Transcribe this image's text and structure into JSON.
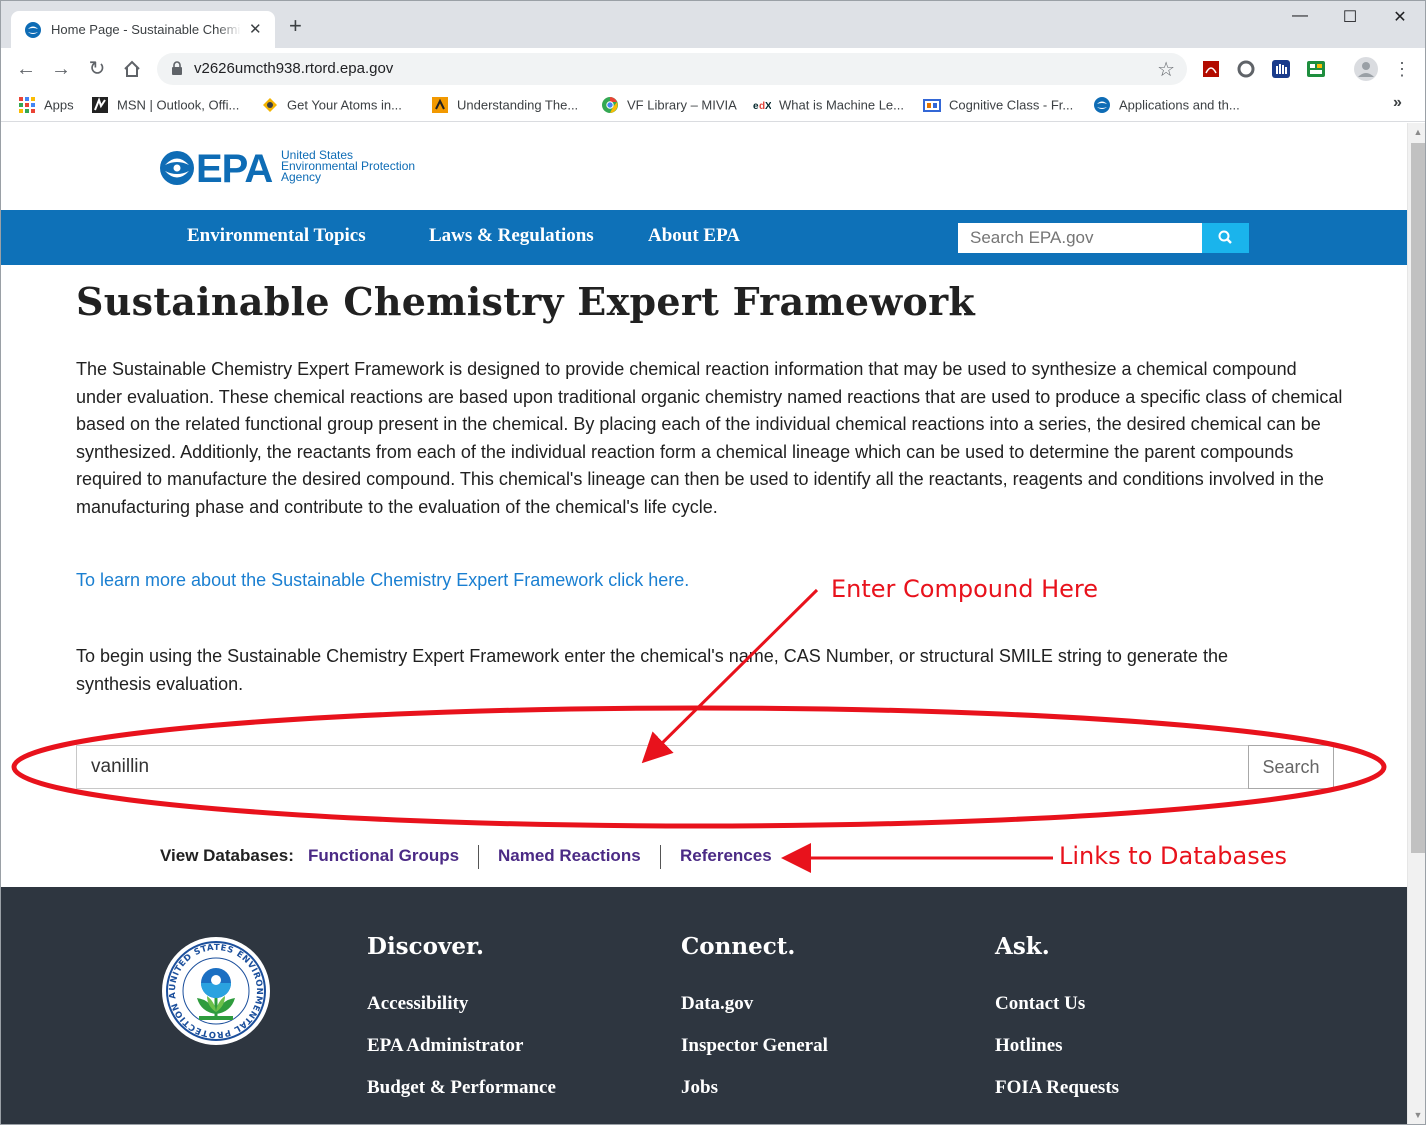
{
  "browser": {
    "tab_title": "Home Page - Sustainable Chemistry Expert Framework",
    "tab_close": "✕",
    "new_tab": "+",
    "url": "v2626umcth938.rtord.epa.gov",
    "window_controls": {
      "minimize": "—",
      "maximize": "☐",
      "close": "✕"
    },
    "bookmarks": [
      {
        "label": "Apps",
        "icon": "apps-grid-icon"
      },
      {
        "label": "MSN | Outlook, Offi...",
        "icon": "msn-icon"
      },
      {
        "label": "Get Your Atoms in...",
        "icon": "atoms-icon"
      },
      {
        "label": "Understanding The...",
        "icon": "bookmark-icon"
      },
      {
        "label": "VF Library – MIVIA",
        "icon": "chrome-icon"
      },
      {
        "label": "What is Machine Le...",
        "icon": "edx-icon"
      },
      {
        "label": "Cognitive Class - Fr...",
        "icon": "cognitive-class-icon"
      },
      {
        "label": "Applications and th...",
        "icon": "epa-icon"
      }
    ],
    "bookmarks_overflow": "»"
  },
  "header": {
    "logo_text": "EPA",
    "agency_lines": [
      "United States",
      "Environmental Protection",
      "Agency"
    ]
  },
  "nav": {
    "items": [
      "Environmental Topics",
      "Laws & Regulations",
      "About EPA"
    ],
    "search_placeholder": "Search EPA.gov"
  },
  "main": {
    "title": "Sustainable Chemistry Expert Framework",
    "intro": "The Sustainable Chemistry Expert Framework is designed to provide chemical reaction information that may be used to synthesize a chemical compound under evaluation. These chemical reactions are based upon traditional organic chemistry named reactions that are used to produce a specific class of chemical based on the related functional group present in the chemical. By placing each of the individual chemical reactions into a series, the desired chemical can be synthesized. Additionly, the reactants from each of the individual reaction form a chemical lineage which can be used to determine the parent compounds required to manufacture the desired compound. This chemical's lineage can then be used to identify all the reactants, reagents and conditions involved in the manufacturing phase and contribute to the evaluation of the chemical's life cycle.",
    "learn_more": "To learn more about the Sustainable Chemistry Expert Framework click here.",
    "begin_text": "To begin using the Sustainable Chemistry Expert Framework enter the chemical's name, CAS Number, or structural SMILE string to generate the synthesis evaluation.",
    "compound_value": "vanillin",
    "search_label": "Search",
    "view_databases_label": "View Databases:",
    "databases": [
      "Functional Groups",
      "Named Reactions",
      "References"
    ]
  },
  "footer": {
    "columns": [
      {
        "heading": "Discover.",
        "links": [
          "Accessibility",
          "EPA Administrator",
          "Budget & Performance"
        ]
      },
      {
        "heading": "Connect.",
        "links": [
          "Data.gov",
          "Inspector General",
          "Jobs"
        ]
      },
      {
        "heading": "Ask.",
        "links": [
          "Contact Us",
          "Hotlines",
          "FOIA Requests"
        ]
      }
    ],
    "seal_text": "UNITED STATES ENVIRONMENTAL PROTECTION AGENCY"
  },
  "annotations": {
    "enter_compound": "Enter Compound Here",
    "links_to_databases": "Links to Databases",
    "color": "#e8121c"
  },
  "colors": {
    "epa_blue": "#0e71b8",
    "nav_search_button": "#1ab4ec",
    "link_blue": "#1a7fd1",
    "db_link_purple": "#4b2a85",
    "footer_bg": "#2e3640"
  }
}
